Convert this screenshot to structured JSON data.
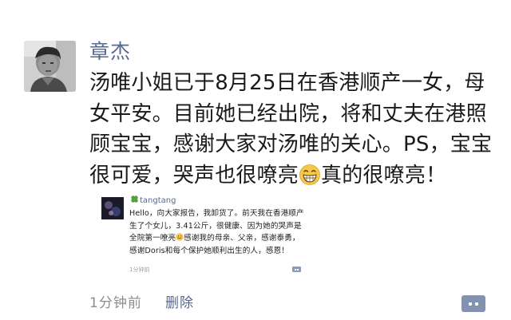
{
  "post": {
    "author": "章杰",
    "text_part1": "汤唯小姐已于8月25日在香港顺产一女，母女平安。目前她已经出院，将和丈夫在港照顾宝宝，感谢大家对汤唯的关心。PS，宝宝很可爱，哭声也很嘹亮",
    "text_part2": "真的很嘹亮！",
    "emoji": "grinning-face-icon"
  },
  "embedded_post": {
    "author": "tangtang",
    "text_part1": "Hello，向大家报告，我卸货了。前天我在香港顺产生了个女儿，3.41公斤，很健康、因为她的哭声是全院第一嘹亮",
    "text_part2": "感谢我的母亲、父亲，感谢泰勇，感谢Doris和每个保护她顺利出生的人，感恩！",
    "time": "1分钟前"
  },
  "footer": {
    "time": "1分钟前",
    "delete_label": "删除",
    "comment_icon": "comment-icon"
  }
}
